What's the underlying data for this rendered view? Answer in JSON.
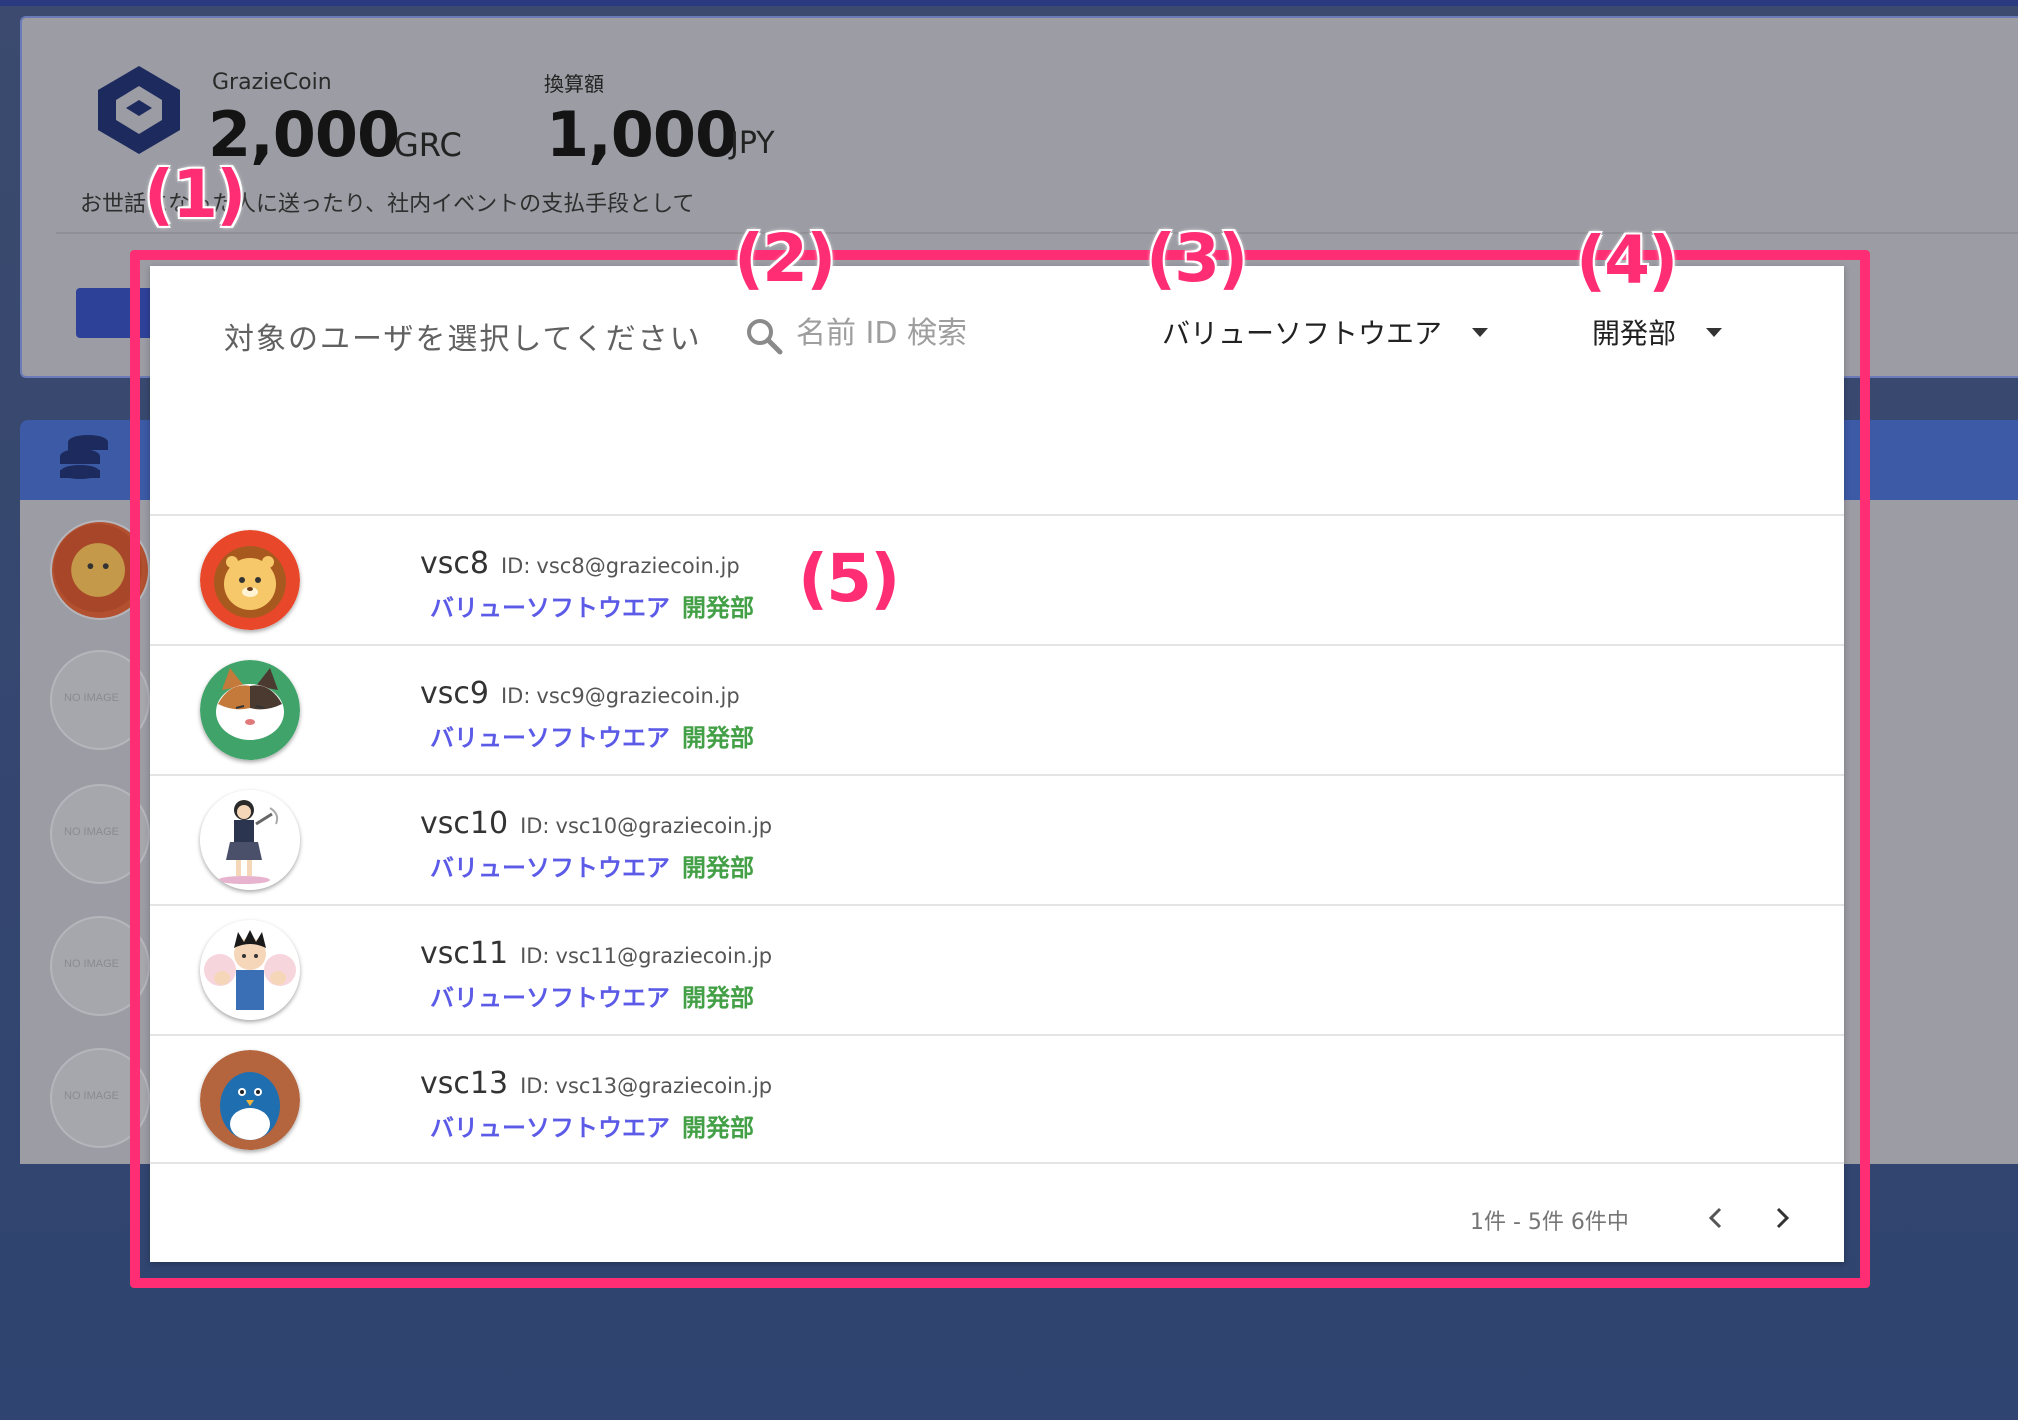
{
  "background": {
    "coin_label": "GrazieCoin",
    "coin_amount": "2,000",
    "coin_unit": "GRC",
    "converted_label": "換算額",
    "converted_amount": "1,000",
    "converted_unit": "JPY",
    "description": "お世話になった人に送ったり、社内イベントの支払手段として",
    "no_image_label": "NO IMAGE"
  },
  "annotations": [
    "(1)",
    "(2)",
    "(3)",
    "(4)",
    "(5)"
  ],
  "dialog": {
    "prompt": "対象のユーザを選択してください",
    "search": {
      "placeholder": "名前 ID 検索",
      "value": ""
    },
    "company_select": {
      "selected": "バリューソフトウエア"
    },
    "department_select": {
      "selected": "開発部"
    },
    "id_label": "ID:",
    "users": [
      {
        "name": "vsc8",
        "id": "vsc8@graziecoin.jp",
        "company": "バリューソフトウエア",
        "department": "開発部",
        "avatar": "lion"
      },
      {
        "name": "vsc9",
        "id": "vsc9@graziecoin.jp",
        "company": "バリューソフトウエア",
        "department": "開発部",
        "avatar": "cat"
      },
      {
        "name": "vsc10",
        "id": "vsc10@graziecoin.jp",
        "company": "バリューソフトウエア",
        "department": "開発部",
        "avatar": "schoolgirl"
      },
      {
        "name": "vsc11",
        "id": "vsc11@graziecoin.jp",
        "company": "バリューソフトウエア",
        "department": "開発部",
        "avatar": "boy"
      },
      {
        "name": "vsc13",
        "id": "vsc13@graziecoin.jp",
        "company": "バリューソフトウエア",
        "department": "開発部",
        "avatar": "penguin"
      }
    ],
    "pagination": {
      "text": "1件 - 5件 6件中"
    }
  },
  "colors": {
    "highlight": "#ff2d73",
    "company": "#5b5be8",
    "department": "#43a047"
  }
}
